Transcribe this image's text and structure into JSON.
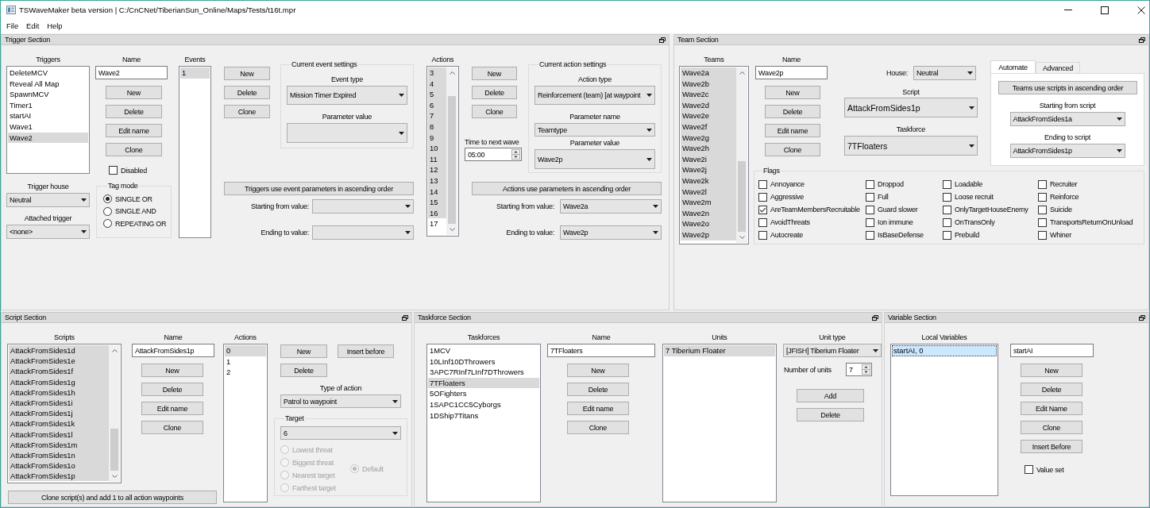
{
  "window": {
    "title": "TSWaveMaker beta version | C:/CnCNet/TiberianSun_Online/Maps/Tests/t16t.mpr"
  },
  "menu": [
    "File",
    "Edit",
    "Help"
  ],
  "trigger_section": {
    "title": "Trigger Section",
    "triggers": {
      "label": "Triggers",
      "items": [
        {
          "text": "DeleteMCV",
          "selected": false
        },
        {
          "text": "Reveal All Map",
          "selected": false
        },
        {
          "text": "SpawnMCV",
          "selected": false
        },
        {
          "text": "Timer1",
          "selected": false
        },
        {
          "text": "startAI",
          "selected": false
        },
        {
          "text": "Wave1",
          "selected": false
        },
        {
          "text": "Wave2",
          "selected": true
        }
      ]
    },
    "trigger_house": {
      "label": "Trigger house",
      "value": "Neutral"
    },
    "attached_trigger": {
      "label": "Attached trigger",
      "value": "<none>"
    },
    "name": {
      "label": "Name",
      "value": "Wave2"
    },
    "buttons": [
      "New",
      "Delete",
      "Edit name",
      "Clone"
    ],
    "disabled": {
      "label": "Disabled",
      "checked": false
    },
    "tag_mode": {
      "title": "Tag mode",
      "options": [
        {
          "label": "SINGLE OR",
          "selected": true
        },
        {
          "label": "SINGLE AND",
          "selected": false
        },
        {
          "label": "REPEATING OR",
          "selected": false
        }
      ]
    },
    "events": {
      "label": "Events",
      "items": [
        {
          "text": "1",
          "selected": true
        }
      ]
    },
    "event_buttons": [
      "New",
      "Delete",
      "Clone"
    ],
    "event_settings": {
      "title": "Current event settings",
      "fields": [
        {
          "label": "Event type",
          "value": "Mission Timer Expired"
        },
        {
          "label": "Parameter value"
        }
      ]
    },
    "event_order_button": "Triggers use event parameters in ascending order",
    "event_range": [
      {
        "label": "Starting from value:"
      },
      {
        "label": "Ending to value:"
      }
    ],
    "actions": {
      "label": "Actions",
      "items": [
        {
          "text": "3",
          "selected": true
        },
        {
          "text": "4",
          "selected": true
        },
        {
          "text": "5",
          "selected": true
        },
        {
          "text": "6",
          "selected": true
        },
        {
          "text": "7",
          "selected": true
        },
        {
          "text": "8",
          "selected": true
        },
        {
          "text": "9",
          "selected": true
        },
        {
          "text": "10",
          "selected": true
        },
        {
          "text": "11",
          "selected": true
        },
        {
          "text": "12",
          "selected": true
        },
        {
          "text": "13",
          "selected": true
        },
        {
          "text": "14",
          "selected": true
        },
        {
          "text": "15",
          "selected": true
        },
        {
          "text": "16",
          "selected": true
        },
        {
          "text": "17",
          "selected": false
        }
      ]
    },
    "action_buttons": [
      "New",
      "Delete",
      "Clone"
    ],
    "time_to_next_wave": {
      "label": "Time to next wave",
      "value": "05:00"
    },
    "action_settings": {
      "title": "Current action settings",
      "fields": [
        {
          "label": "Action type",
          "value": "Reinforcement (team) [at waypoint"
        },
        {
          "label": "Parameter name",
          "value": "Teamtype"
        },
        {
          "label": "Parameter value",
          "value": "Wave2p"
        }
      ]
    },
    "action_order_button": "Actions use parameters in ascending order",
    "action_range": [
      {
        "label": "Starting from value:",
        "value": "Wave2a"
      },
      {
        "label": "Ending to value:",
        "value": "Wave2p"
      }
    ]
  },
  "team_section": {
    "title": "Team Section",
    "teams": {
      "label": "Teams",
      "items": [
        {
          "text": "Wave2a",
          "selected": true
        },
        {
          "text": "Wave2b",
          "selected": true
        },
        {
          "text": "Wave2c",
          "selected": true
        },
        {
          "text": "Wave2d",
          "selected": true
        },
        {
          "text": "Wave2e",
          "selected": true
        },
        {
          "text": "Wave2f",
          "selected": true
        },
        {
          "text": "Wave2g",
          "selected": true
        },
        {
          "text": "Wave2h",
          "selected": true
        },
        {
          "text": "Wave2i",
          "selected": true
        },
        {
          "text": "Wave2j",
          "selected": true
        },
        {
          "text": "Wave2k",
          "selected": true
        },
        {
          "text": "Wave2l",
          "selected": true
        },
        {
          "text": "Wave2m",
          "selected": true
        },
        {
          "text": "Wave2n",
          "selected": true
        },
        {
          "text": "Wave2o",
          "selected": true
        },
        {
          "text": "Wave2p",
          "selected": true
        }
      ]
    },
    "name": {
      "label": "Name",
      "value": "Wave2p"
    },
    "buttons": [
      "New",
      "Delete",
      "Edit name",
      "Clone"
    ],
    "house": {
      "label": "House:",
      "value": "Neutral"
    },
    "script": {
      "label": "Script",
      "value": "AttackFromSides1p"
    },
    "taskforce": {
      "label": "Taskforce",
      "value": "7TFloaters"
    },
    "tabs": [
      {
        "label": "Automate",
        "selected": true
      },
      {
        "label": "Advanced",
        "selected": false
      }
    ],
    "automate": {
      "order_button": "Teams use scripts in ascending order",
      "starting_script": {
        "label": "Starting from script",
        "value": "AttackFromSides1a"
      },
      "ending_script": {
        "label": "Ending to script",
        "value": "AttackFromSides1p"
      }
    },
    "flags": {
      "title": "Flags",
      "items": [
        {
          "label": "Annoyance",
          "checked": false
        },
        {
          "label": "Aggressive",
          "checked": false
        },
        {
          "label": "AreTeamMembersRecruitable",
          "checked": true
        },
        {
          "label": "AvoidThreats",
          "checked": false
        },
        {
          "label": "Autocreate",
          "checked": false
        },
        {
          "label": "Droppod",
          "checked": false
        },
        {
          "label": "Full",
          "checked": false
        },
        {
          "label": "Guard slower",
          "checked": false
        },
        {
          "label": "Ion immune",
          "checked": false
        },
        {
          "label": "IsBaseDefense",
          "checked": false
        },
        {
          "label": "Loadable",
          "checked": false
        },
        {
          "label": "Loose recruit",
          "checked": false
        },
        {
          "label": "OnlyTargetHouseEnemy",
          "checked": false
        },
        {
          "label": "OnTransOnly",
          "checked": false
        },
        {
          "label": "Prebuild",
          "checked": false
        },
        {
          "label": "Recruiter",
          "checked": false
        },
        {
          "label": "Reinforce",
          "checked": false
        },
        {
          "label": "Suicide",
          "checked": false
        },
        {
          "label": "TransportsReturnOnUnload",
          "checked": false
        },
        {
          "label": "Whiner",
          "checked": false
        }
      ]
    }
  },
  "script_section": {
    "title": "Script Section",
    "scripts": {
      "label": "Scripts",
      "items": [
        {
          "text": "AttackFromSides1d",
          "selected": true
        },
        {
          "text": "AttackFromSides1e",
          "selected": true
        },
        {
          "text": "AttackFromSides1f",
          "selected": true
        },
        {
          "text": "AttackFromSides1g",
          "selected": true
        },
        {
          "text": "AttackFromSides1h",
          "selected": true
        },
        {
          "text": "AttackFromSides1i",
          "selected": true
        },
        {
          "text": "AttackFromSides1j",
          "selected": true
        },
        {
          "text": "AttackFromSides1k",
          "selected": true
        },
        {
          "text": "AttackFromSides1l",
          "selected": true
        },
        {
          "text": "AttackFromSides1m",
          "selected": true
        },
        {
          "text": "AttackFromSides1n",
          "selected": true
        },
        {
          "text": "AttackFromSides1o",
          "selected": true
        },
        {
          "text": "AttackFromSides1p",
          "selected": true
        }
      ]
    },
    "name": {
      "label": "Name",
      "value": "AttackFromSides1p"
    },
    "buttons": [
      "New",
      "Delete",
      "Edit name",
      "Clone"
    ],
    "clone_add_button": "Clone script(s) and add 1 to all action waypoints",
    "actions": {
      "label": "Actions",
      "items": [
        {
          "text": "0",
          "selected": true
        },
        {
          "text": "1",
          "selected": false
        },
        {
          "text": "2",
          "selected": false
        }
      ]
    },
    "action_buttons": [
      "New",
      "Insert before",
      "Delete"
    ],
    "type_of_action": {
      "label": "Type of action",
      "value": "Patrol to waypoint"
    },
    "target": {
      "title": "Target",
      "value": "6",
      "options": [
        {
          "label": "Lowest threat",
          "selected": false,
          "disabled": true
        },
        {
          "label": "Biggest threat",
          "selected": false,
          "disabled": true
        },
        {
          "label": "Nearest target",
          "selected": false,
          "disabled": true
        },
        {
          "label": "Farthest target",
          "selected": false,
          "disabled": true
        },
        {
          "label": "Default",
          "selected": true,
          "disabled": true
        }
      ]
    }
  },
  "taskforce_section": {
    "title": "Taskforce Section",
    "taskforces": {
      "label": "Taskforces",
      "items": [
        {
          "text": "1MCV",
          "selected": false
        },
        {
          "text": "10LInf10DThrowers",
          "selected": false
        },
        {
          "text": "3APC7RInf7LInf7DThrowers",
          "selected": false
        },
        {
          "text": "7TFloaters",
          "selected": true
        },
        {
          "text": "5OFighters",
          "selected": false
        },
        {
          "text": "1SAPC1CC5Cyborgs",
          "selected": false
        },
        {
          "text": "1DShip7Titans",
          "selected": false
        }
      ]
    },
    "name": {
      "label": "Name",
      "value": "7TFloaters"
    },
    "buttons": [
      "New",
      "Delete",
      "Edit name",
      "Clone"
    ],
    "units": {
      "label": "Units",
      "items": [
        {
          "text": "7 Tiberium Floater",
          "selected": true
        }
      ]
    },
    "unit_type": {
      "label": "Unit type",
      "value": "[JFISH] Tiberium Floater"
    },
    "number_of_units": {
      "label": "Number of units",
      "value": "7"
    },
    "unit_buttons": [
      "Add",
      "Delete"
    ]
  },
  "variable_section": {
    "title": "Variable Section",
    "local_variables": {
      "label": "Local Variables",
      "focused": true,
      "items": [
        {
          "text": "startAI, 0",
          "selected": true
        }
      ]
    },
    "name": {
      "value": "startAI"
    },
    "buttons": [
      "New",
      "Delete",
      "Edit Name",
      "Clone",
      "Insert Before"
    ],
    "value_set": {
      "label": "Value set",
      "checked": false
    }
  }
}
